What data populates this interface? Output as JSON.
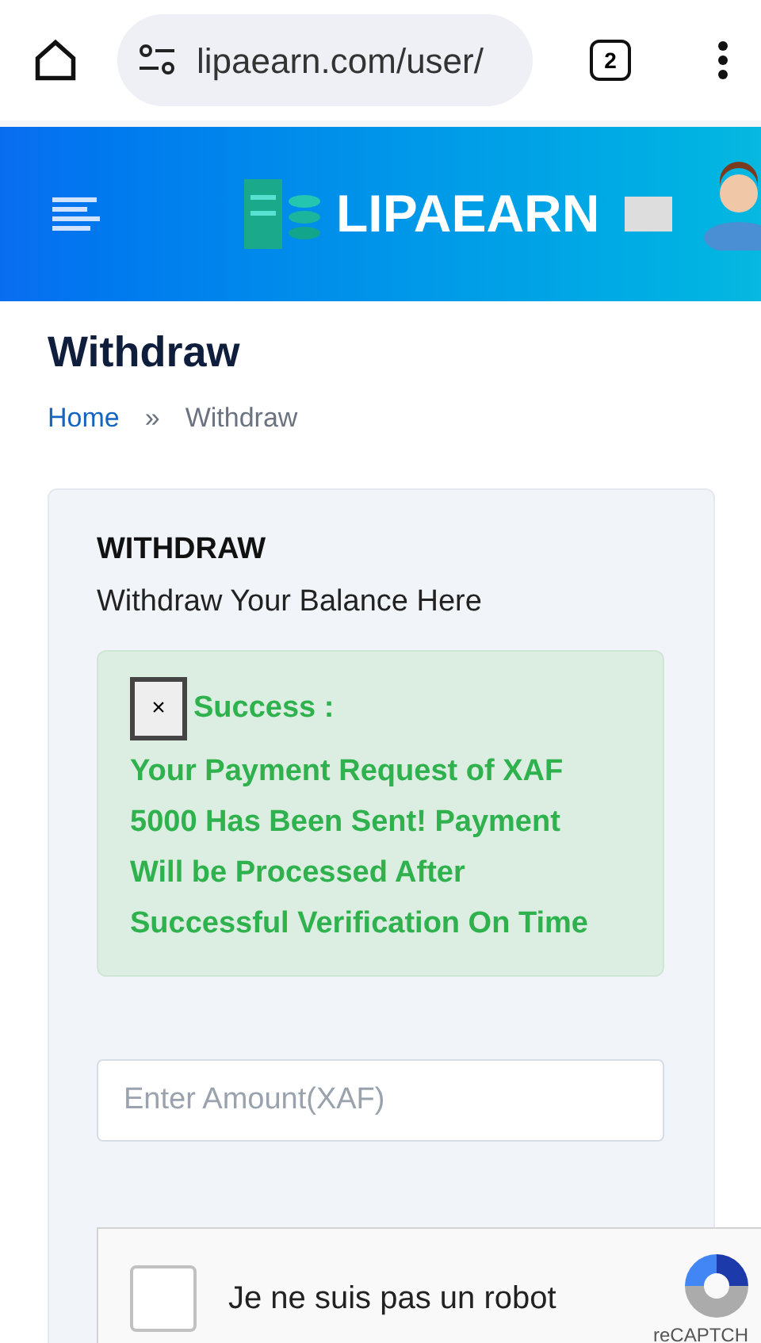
{
  "browser": {
    "url": "lipaearn.com/user/",
    "tab_count": "2"
  },
  "header": {
    "brand": "LIPAEARN"
  },
  "page": {
    "title": "Withdraw",
    "breadcrumb": [
      "Home",
      "»",
      "Withdraw"
    ]
  },
  "card": {
    "heading": "WITHDRAW",
    "subheading": "Withdraw Your Balance Here",
    "alert": {
      "close": "×",
      "title": "Success :",
      "message": "Your Payment Request of XAF 5000 Has Been Sent! Payment Will be Processed After Successful Verification On Time"
    },
    "amount_field": {
      "placeholder": "Enter Amount(XAF)"
    },
    "captcha": {
      "label": "Je ne suis pas un robot",
      "checked": false,
      "brand": "reCAPTCH"
    }
  }
}
